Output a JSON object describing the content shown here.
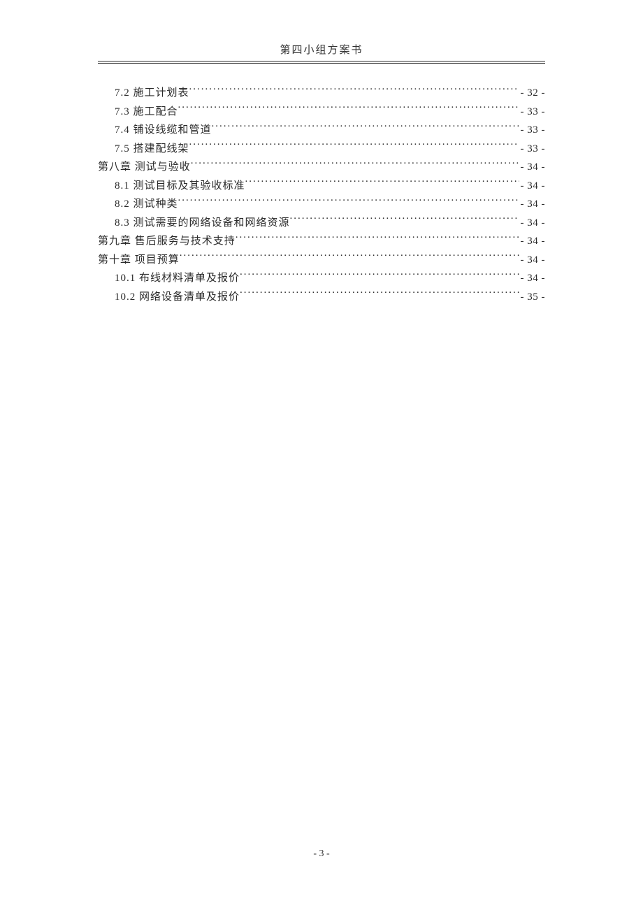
{
  "header": {
    "title": "第四小组方案书"
  },
  "toc": {
    "entries": [
      {
        "level": 2,
        "label": "7.2  施工计划表 ",
        "page": "- 32 -"
      },
      {
        "level": 2,
        "label": "7.3  施工配合 ",
        "page": "- 33 -"
      },
      {
        "level": 2,
        "label": "7.4  铺设线缆和管道",
        "page": "- 33 -"
      },
      {
        "level": 2,
        "label": "7.5  搭建配线架 ",
        "page": "- 33 -"
      },
      {
        "level": 1,
        "label": "第八章  测试与验收",
        "page": "- 34 -"
      },
      {
        "level": 2,
        "label": "8.1  测试目标及其验收标准",
        "page": "- 34 -"
      },
      {
        "level": 2,
        "label": "8.2  测试种类 ",
        "page": "- 34 -"
      },
      {
        "level": 2,
        "label": "8.3  测试需要的网络设备和网络资源",
        "page": "- 34 -"
      },
      {
        "level": 1,
        "label": "第九章  售后服务与技术支持",
        "page": "- 34 -"
      },
      {
        "level": 1,
        "label": "第十章  项目预算 ",
        "page": "- 34 -"
      },
      {
        "level": 2,
        "label": "10.1  布线材料清单及报价",
        "page": "- 34 -"
      },
      {
        "level": 2,
        "label": "10.2  网络设备清单及报价",
        "page": "- 35 -"
      }
    ]
  },
  "footer": {
    "page_number": "- 3 -"
  }
}
